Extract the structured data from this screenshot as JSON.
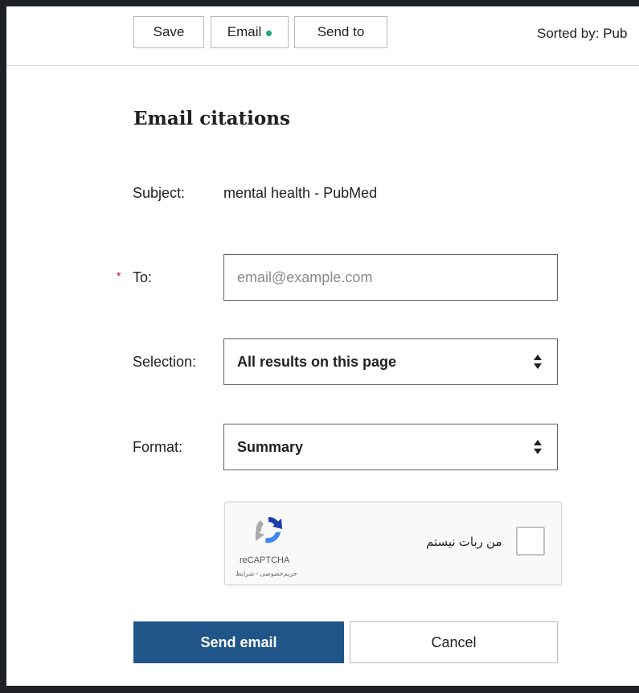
{
  "toolbar": {
    "save_label": "Save",
    "email_label": "Email",
    "send_to_label": "Send to",
    "sorted_by": "Sorted by: Pub"
  },
  "form": {
    "heading": "Email citations",
    "subject_label": "Subject:",
    "subject_value": "mental health - PubMed",
    "required_mark": "*",
    "to_label": "To:",
    "to_placeholder": "email@example.com",
    "to_value": "",
    "selection_label": "Selection:",
    "selection_value": "All results on this page",
    "format_label": "Format:",
    "format_value": "Summary"
  },
  "captcha": {
    "checkbox_text": "من ربات نیستم",
    "brand": "reCAPTCHA",
    "terms": "حریم‌خصوصی - شرایط"
  },
  "actions": {
    "send_label": "Send email",
    "cancel_label": "Cancel"
  },
  "colors": {
    "primary": "#20558a",
    "email_dot": "#20a57f",
    "required": "#d0021b"
  }
}
